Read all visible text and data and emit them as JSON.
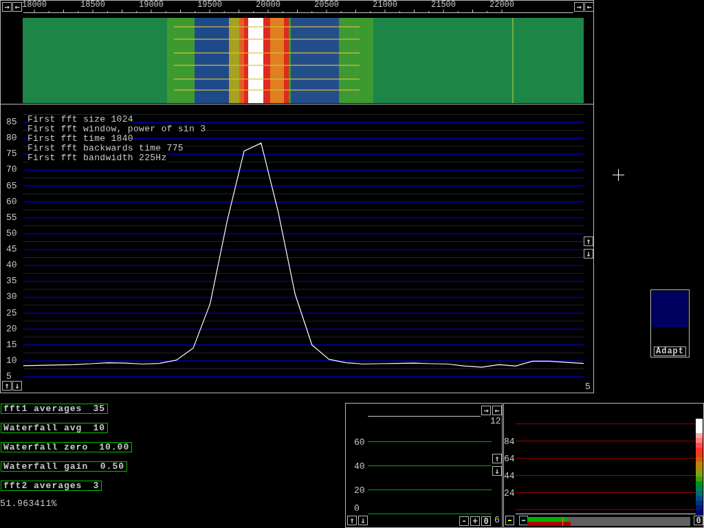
{
  "spectrum_window": {
    "scale_buttons": [
      "→",
      "←",
      "→",
      "←"
    ],
    "frequency_labels": [
      "18000",
      "18500",
      "19000",
      "19500",
      "20000",
      "20500",
      "21000",
      "21500",
      "22000"
    ],
    "info_lines": [
      "First fft size 1024",
      "First fft window, power of sin 3",
      "First fft time 1840",
      "First fft backwards time 775",
      "First fft bandwidth 225Hz"
    ],
    "chart_data": {
      "type": "line",
      "ylim": [
        5,
        85
      ],
      "grid": true,
      "yticks": [
        5,
        10,
        15,
        20,
        25,
        30,
        35,
        40,
        45,
        50,
        55,
        60,
        65,
        70,
        75,
        80,
        85
      ],
      "categories": [
        null,
        null,
        null,
        null,
        null,
        null,
        null,
        null,
        null,
        null,
        null,
        null,
        null,
        null,
        null,
        null,
        null,
        null,
        null,
        null,
        null,
        null,
        null,
        null,
        null,
        null,
        null,
        null,
        null,
        null,
        null,
        null,
        null,
        null
      ],
      "series": [
        {
          "color": "#ffffff",
          "values": [
            8.5,
            8.6,
            8.7,
            8.8,
            9.1,
            9.4,
            9.3,
            9.0,
            9.2,
            10.2,
            14,
            28,
            54,
            76,
            78.5,
            57,
            31,
            15,
            10.5,
            9.4,
            9.0,
            9.1,
            9.2,
            9.3,
            9.1,
            9.0,
            8.4,
            8.0,
            8.8,
            8.4,
            9.9,
            9.9,
            9.5,
            9.2
          ]
        }
      ]
    },
    "y_scroll_buttons": [
      "↑",
      "↓"
    ],
    "bottom_buttons": [
      "↑",
      "↓"
    ],
    "corner_label": "5"
  },
  "parameters": [
    {
      "label": "fft1 averages",
      "value": "35"
    },
    {
      "label": "Waterfall avg",
      "value": "10"
    },
    {
      "label": "Waterfall zero",
      "value": "10.00"
    },
    {
      "label": "Waterfall gain",
      "value": "0.50"
    },
    {
      "label": "fft2 averages",
      "value": "3"
    }
  ],
  "percentage": "51.963411%",
  "fft2_window": {
    "y_labels": [
      "60",
      "40",
      "20",
      "0"
    ],
    "top_label": "12",
    "bottom_label": "6",
    "top_buttons": [
      "→",
      "←"
    ],
    "side_buttons": [
      "↑",
      "↓"
    ],
    "bottom_left_buttons": [
      "↑",
      "↓"
    ],
    "bottom_right_buttons": [
      "-",
      "+",
      "0"
    ]
  },
  "level_window": {
    "y_labels": [
      "84",
      "64",
      "44",
      "24"
    ],
    "color_buttons": [
      {
        "color": "#e0e000"
      },
      {
        "color": "#40e0e0"
      }
    ],
    "meters": [
      {
        "color": "#00b000",
        "level": 0.25
      },
      {
        "color": "#b00000",
        "level": 0.265
      }
    ],
    "reset_button": "0"
  },
  "adapt_panel": {
    "level": 0.57,
    "button": "Adapt"
  }
}
